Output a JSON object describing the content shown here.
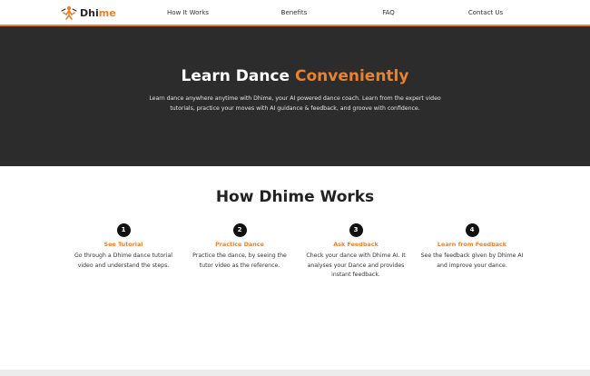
{
  "brand": {
    "logo_icon": "dancer-logo-icon",
    "name_prefix": "Dhi",
    "name_suffix": "me",
    "accent_color": "#e8822c"
  },
  "nav": {
    "links": [
      "How It Works",
      "Benefits",
      "FAQ",
      "Contact Us"
    ]
  },
  "hero": {
    "title_plain": "Learn Dance ",
    "title_accent": "Conveniently",
    "description": "Learn dance anywhere anytime with Dhime, your AI powered dance coach. Learn from the expert video tutorials, practice your moves with AI guidance & feedback, and groove with confidence.",
    "background_color": "#2c2c2c"
  },
  "how_it_works": {
    "title": "How Dhime Works",
    "steps": [
      {
        "number": "1",
        "title": "See Tutorial",
        "description": "Go through a Dhime dance tutorial video and understand the steps."
      },
      {
        "number": "2",
        "title": "Practice Dance",
        "description": "Practice the dance, by seeing the tutor video as the reference."
      },
      {
        "number": "3",
        "title": "Ask Feedback",
        "description": "Check your dance with Dhime AI. It analyses your Dance and provides instant feedback."
      },
      {
        "number": "4",
        "title": "Learn from Feedback",
        "description": "See the feedback given by Dhime AI and improve your dance."
      }
    ]
  }
}
